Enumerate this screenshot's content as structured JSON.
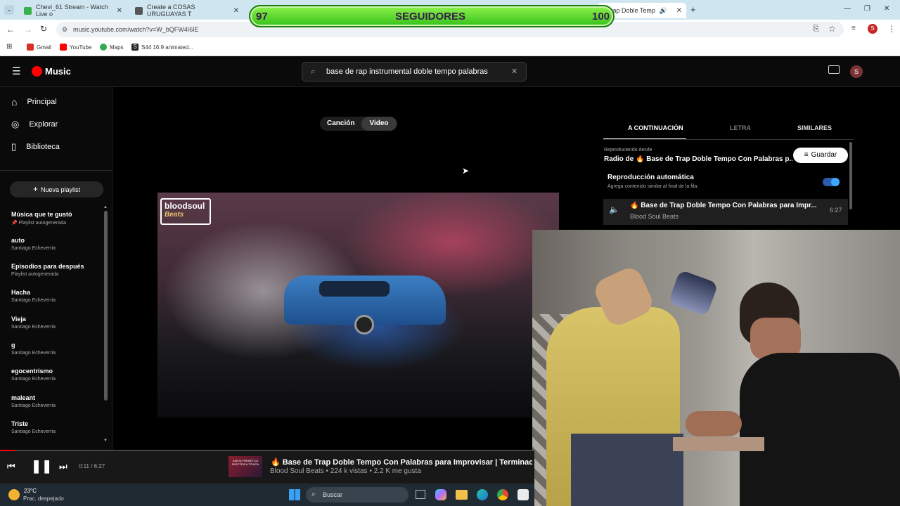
{
  "browser": {
    "tabs": [
      {
        "title": "Chevi_61 Stream - Watch Live o",
        "color": "#37b24d"
      },
      {
        "title": "Create a COSAS URUGUAYAS T",
        "color": "#444444"
      },
      {
        "title": "",
        "color": "#444444"
      },
      {
        "title": "e Trap Doble Temp",
        "color": "#ff0000"
      }
    ],
    "url": "music.youtube.com/watch?v=W_bQFW4I6lE",
    "bookmarks": [
      {
        "label": "Gmail",
        "color": "#d93025"
      },
      {
        "label": "YouTube",
        "color": "#ff0000"
      },
      {
        "label": "Maps",
        "color": "#34a853"
      },
      {
        "label": "S44 16:9 animated...",
        "color": "#222222"
      }
    ]
  },
  "overlay": {
    "left_count": "97",
    "title": "SEGUIDORES",
    "right_count": "100"
  },
  "ytmusic": {
    "logo": "Music",
    "search_value": "base de rap instrumental doble tempo palabras",
    "avatar_letter": "S",
    "nav": [
      "Principal",
      "Explorar",
      "Biblioteca"
    ],
    "new_playlist": "Nueva playlist",
    "playlists": [
      {
        "title": "Música que te gustó",
        "subtitle": "📌 Playlist autogenerada"
      },
      {
        "title": "auto",
        "subtitle": "Santiago Echeverria"
      },
      {
        "title": "Episodios para después",
        "subtitle": "Playlist autogenerada"
      },
      {
        "title": "Hacha",
        "subtitle": "Santiago Echeverria"
      },
      {
        "title": "Vieja",
        "subtitle": "Santiago Echeverria"
      },
      {
        "title": "g",
        "subtitle": "Santiago Echeverria"
      },
      {
        "title": "egocentrismo",
        "subtitle": "Santiago Echeverria"
      },
      {
        "title": "maleant",
        "subtitle": "Santiago Echeverria"
      },
      {
        "title": "Triste",
        "subtitle": "Santiago Echeverria"
      }
    ],
    "toggle": {
      "song": "Canción",
      "video": "Video"
    },
    "video_logo": {
      "top": "bloodsoul",
      "bottom": "Beats"
    },
    "right_tabs": [
      "A CONTINUACIÓN",
      "LETRA",
      "SIMILARES"
    ],
    "queue": {
      "playing_from_label": "Reproduciendo desde",
      "playing_from": "Radio de 🔥 Base de Trap Doble Tempo Con Palabras p...",
      "save_button": "Guardar",
      "autoplay_title": "Reproducción automática",
      "autoplay_sub": "Agrega contenido similar al final de la fila.",
      "autoplay_on": true,
      "item_title": "🔥 Base de Trap Doble Tempo Con Palabras para Impr...",
      "item_artist": "Blood Soul Beats",
      "item_duration": "6:27"
    },
    "player": {
      "time": "0:11 / 6:27",
      "progress_fraction": 0.028,
      "title": "🔥 Base de Trap Doble Tempo Con Palabras para Improvisar | Terminaciones +",
      "meta": "Blood Soul Beats • 224 k vistas • 2.2 K me gusta",
      "thumb_text": "SANTA FRENÉTICA ELÉCTRICA TÓXICA"
    }
  },
  "taskbar": {
    "temp": "23°C",
    "weather": "Prac. despejado",
    "search": "Buscar"
  }
}
